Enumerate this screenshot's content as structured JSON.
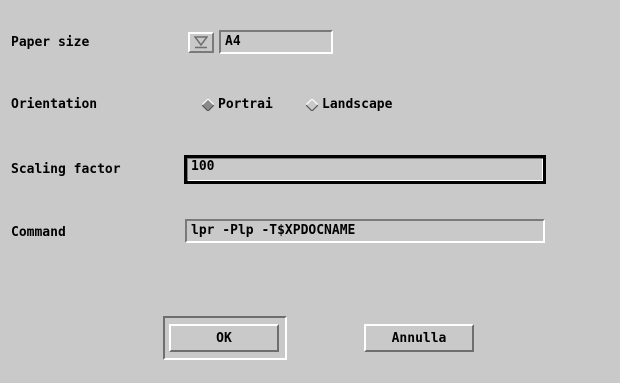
{
  "paper_size": {
    "label": "Paper size",
    "value": "A4",
    "menu_icon": "option-menu-icon"
  },
  "orientation": {
    "label": "Orientation",
    "options": [
      {
        "label": "Portrai",
        "selected": true
      },
      {
        "label": "Landscape",
        "selected": false
      }
    ]
  },
  "scaling": {
    "label": "Scaling factor",
    "value": "100"
  },
  "command": {
    "label": "Command",
    "value": "lpr -Plp -T$XPDOCNAME"
  },
  "buttons": {
    "ok": "OK",
    "cancel": "Annulla"
  }
}
